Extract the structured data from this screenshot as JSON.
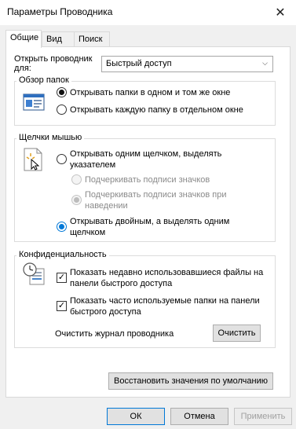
{
  "window": {
    "title": "Параметры Проводника",
    "close_glyph": "✕"
  },
  "tabs": [
    {
      "label": "Общие",
      "active": true
    },
    {
      "label": "Вид",
      "active": false
    },
    {
      "label": "Поиск",
      "active": false
    }
  ],
  "open_explorer": {
    "label": "Открыть проводник для:",
    "selected": "Быстрый доступ"
  },
  "browse_folders": {
    "title": "Обзор папок",
    "icon": "folder-window-icon",
    "options": [
      {
        "label": "Открывать папки в одном и том же окне",
        "checked": true
      },
      {
        "label": "Открывать каждую папку в отдельном окне",
        "checked": false
      }
    ]
  },
  "mouse_clicks": {
    "title": "Щелчки мышью",
    "icon": "mouse-cursor-icon",
    "single_click": {
      "line1": "Открывать одним щелчком, выделять",
      "line2": "указателем",
      "checked": false
    },
    "underline_always": {
      "label": "Подчеркивать подписи значков",
      "checked": false,
      "disabled": true
    },
    "underline_hover": {
      "line1": "Подчеркивать подписи значков при",
      "line2": "наведении",
      "checked": true,
      "disabled": true
    },
    "double_click": {
      "line1": "Открывать двойным, а выделять одним",
      "line2": "щелчком",
      "checked": true
    }
  },
  "privacy": {
    "title": "Конфиденциальность",
    "icon": "clock-documents-icon",
    "recent_files": {
      "line1": "Показать недавно использовавшиеся файлы на",
      "line2": "панели быстрого доступа",
      "checked": true
    },
    "frequent_folders": {
      "line1": "Показать часто используемые папки на панели",
      "line2": "быстрого доступа",
      "checked": true
    },
    "clear_history_label": "Очистить журнал проводника",
    "clear_button": "Очистить"
  },
  "restore_defaults": "Восстановить значения по умолчанию",
  "footer": {
    "ok": "ОК",
    "cancel": "Отмена",
    "apply": "Применить"
  },
  "colors": {
    "accent": "#0078d7",
    "panel_bg": "#ffffff",
    "window_bg": "#f0f0f0"
  }
}
